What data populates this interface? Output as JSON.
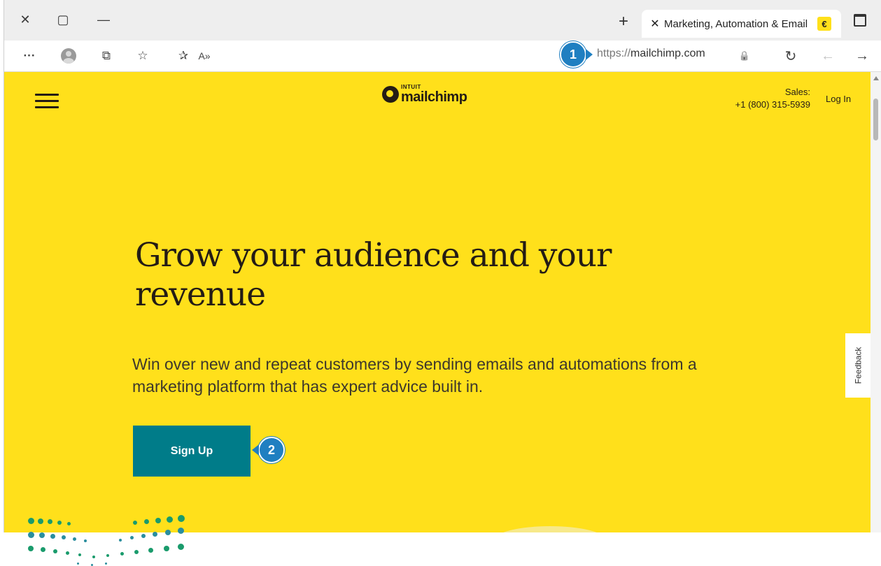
{
  "window": {
    "close_glyph": "✕",
    "maximize_glyph": "▢",
    "minimize_glyph": "—"
  },
  "tab": {
    "new_tab_glyph": "+",
    "close_glyph": "✕",
    "title": "Marketing, Automation & Email",
    "favicon_glyph": "€"
  },
  "toolbar": {
    "more_glyph": "···",
    "tab_actions_glyph": "⧉",
    "favorites_glyph": "☆",
    "collections_glyph": "✰",
    "read_aloud_glyph": "A»",
    "url_scheme": "https://",
    "url_host": "mailchimp.com",
    "lock_glyph": "🔒",
    "refresh_glyph": "↻",
    "back_glyph": "←",
    "forward_glyph": "→"
  },
  "callouts": {
    "one": "1",
    "two": "2"
  },
  "site": {
    "logo_top": "INTUIT",
    "logo_name": "mailchimp",
    "sales_label": "Sales:",
    "sales_phone": "+1 (800) 315-5939",
    "login_label": "Log In",
    "headline": "Grow your audience and your revenue",
    "subtitle": "Win over new and repeat customers by sending emails and automations from a marketing platform that has expert advice built in.",
    "signup_label": "Sign Up",
    "feedback_label": "Feedback"
  },
  "colors": {
    "page_bg": "#ffe01b",
    "button_bg": "#007c89",
    "callout": "#1f7fc1",
    "text_dark": "#241c15",
    "dots_green": "#1a9b6c",
    "dots_teal": "#2a8e9e"
  }
}
